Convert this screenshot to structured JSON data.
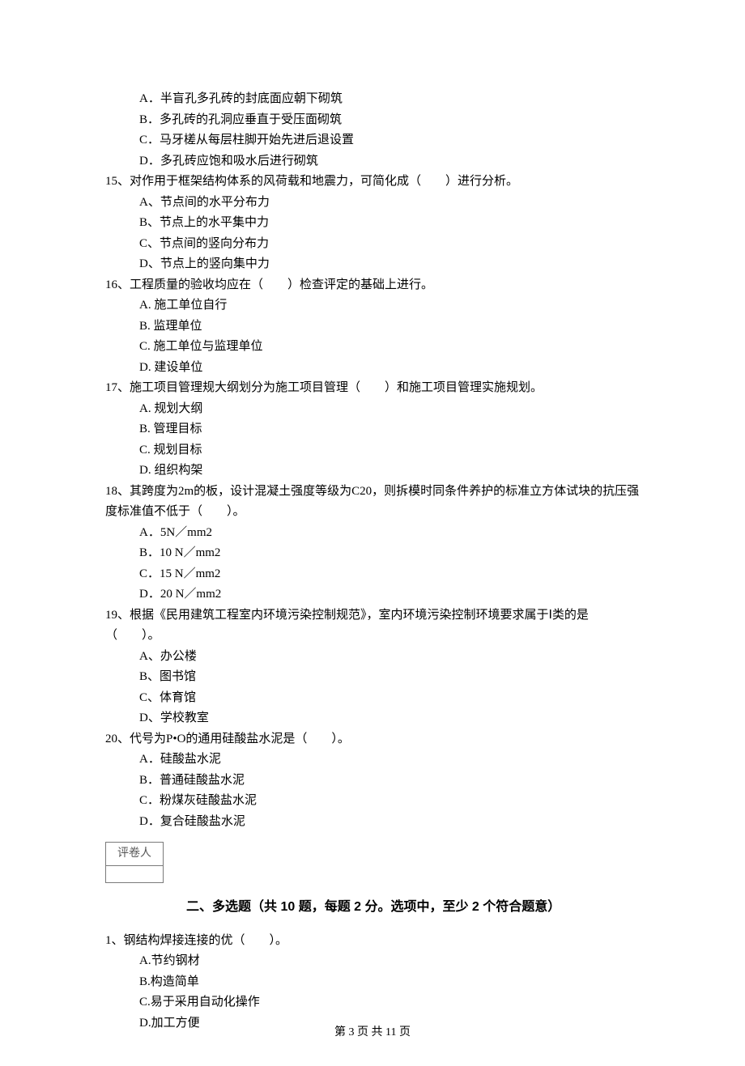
{
  "options_pre": [
    "A．半盲孔多孔砖的封底面应朝下砌筑",
    "B．多孔砖的孔洞应垂直于受压面砌筑",
    "C．马牙槎从每层柱脚开始先进后退设置",
    "D．多孔砖应饱和吸水后进行砌筑"
  ],
  "questions": [
    {
      "stem": "15、对作用于框架结构体系的风荷载和地震力，可简化成（　　）进行分析。",
      "options": [
        "A、节点间的水平分布力",
        "B、节点上的水平集中力",
        "C、节点间的竖向分布力",
        "D、节点上的竖向集中力"
      ]
    },
    {
      "stem": "16、工程质量的验收均应在（　　）检查评定的基础上进行。",
      "options": [
        "A. 施工单位自行",
        "B. 监理单位",
        "C. 施工单位与监理单位",
        "D. 建设单位"
      ]
    },
    {
      "stem": "17、施工项目管理规大纲划分为施工项目管理（　　）和施工项目管理实施规划。",
      "options": [
        "A. 规划大纲",
        "B. 管理目标",
        "C. 规划目标",
        "D. 组织构架"
      ]
    },
    {
      "stem": "18、其跨度为2m的板，设计混凝土强度等级为C20，则拆模时同条件养护的标准立方体试块的抗压强度标准值不低于（　　）。",
      "options": [
        "A．5N／mm2",
        "B．10 N／mm2",
        "C．15 N／mm2",
        "D．20 N／mm2"
      ],
      "hanging": true
    },
    {
      "stem": "19、根据《民用建筑工程室内环境污染控制规范》，室内环境污染控制环境要求属于Ⅰ类的是（　　）。",
      "options": [
        "A、办公楼",
        "B、图书馆",
        "C、体育馆",
        "D、学校教室"
      ],
      "hanging": true
    },
    {
      "stem": "20、代号为P•O的通用硅酸盐水泥是（　　）。",
      "options": [
        "A．硅酸盐水泥",
        "B．普通硅酸盐水泥",
        "C．粉煤灰硅酸盐水泥",
        "D．复合硅酸盐水泥"
      ]
    }
  ],
  "scorer_label": "评卷人",
  "section2_title": "二、多选题（共 10 题，每题 2 分。选项中，至少 2 个符合题意）",
  "section2_q1": {
    "stem": "1、钢结构焊接连接的优（　　）。",
    "options": [
      "A.节约钢材",
      "B.构造简单",
      "C.易于采用自动化操作",
      "D.加工方便"
    ]
  },
  "footer": "第 3 页 共 11 页"
}
